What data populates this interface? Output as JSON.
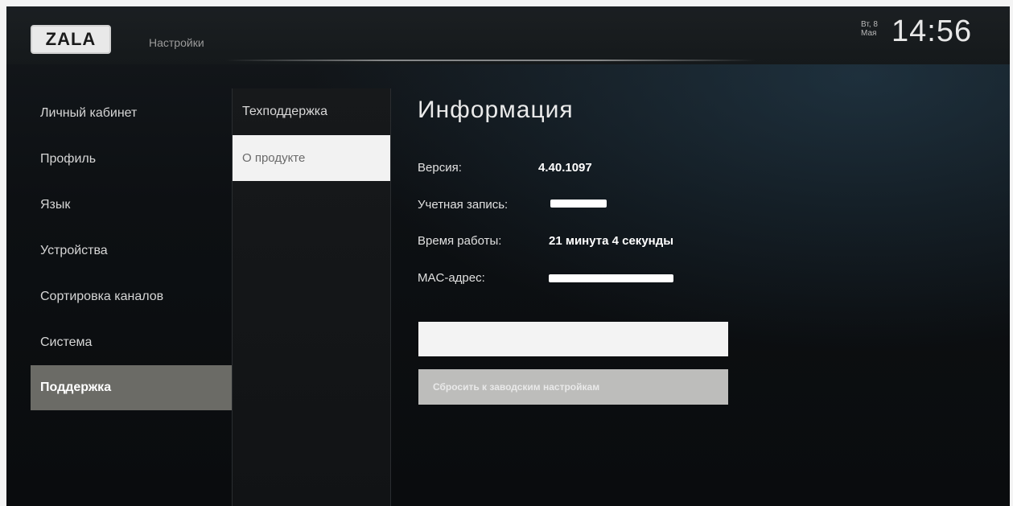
{
  "header": {
    "logo_text": "ZALA",
    "title": "Настройки",
    "date_day": "Вт, 8",
    "date_month": "Мая",
    "time": "14:56"
  },
  "menu": {
    "items": [
      {
        "label": "Личный кабинет",
        "active": false
      },
      {
        "label": "Профиль",
        "active": false
      },
      {
        "label": "Язык",
        "active": false
      },
      {
        "label": "Устройства",
        "active": false
      },
      {
        "label": "Сортировка каналов",
        "active": false
      },
      {
        "label": "Система",
        "active": false
      },
      {
        "label": "Поддержка",
        "active": true
      }
    ]
  },
  "submenu": {
    "items": [
      {
        "label": "Техподдержка",
        "selected": false
      },
      {
        "label": "О продукте",
        "selected": true
      }
    ]
  },
  "info": {
    "title": "Информация",
    "version_label": "Версия:",
    "version_value": "4.40.1097",
    "account_label": "Учетная запись:",
    "uptime_label": "Время работы:",
    "uptime_value": "21 минута 4 секунды",
    "mac_label": "MAC-адрес:"
  },
  "buttons": {
    "reset_label": "Сбросить к заводским настройкам"
  },
  "colors": {
    "active_menu_bg": "#6b6b66",
    "selected_submenu_bg": "#f2f2f2",
    "button_white": "#f3f3f3",
    "button_gray": "#bdbdbb"
  }
}
